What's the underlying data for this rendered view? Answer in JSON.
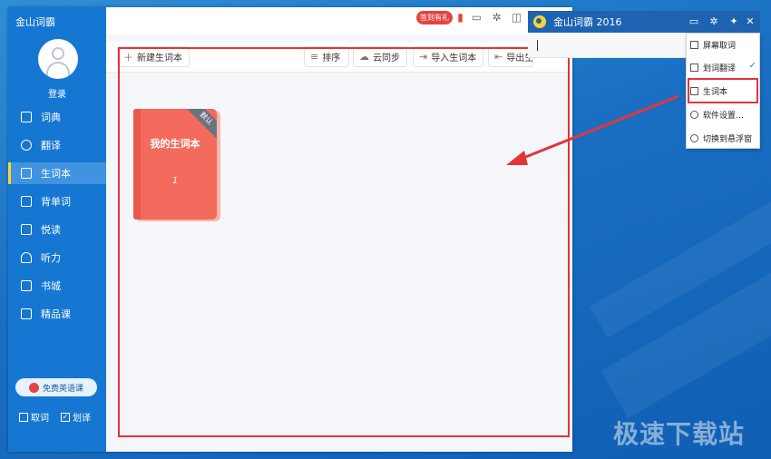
{
  "app": {
    "title": "金山词霸",
    "login": "登录",
    "nav": [
      {
        "label": "词典",
        "icon": "dictionary-icon",
        "glyph": "词"
      },
      {
        "label": "翻译",
        "icon": "translate-icon",
        "glyph": "译"
      },
      {
        "label": "生词本",
        "icon": "wordbook-icon",
        "glyph": "本"
      },
      {
        "label": "背单词",
        "icon": "memorize-icon",
        "glyph": "A"
      },
      {
        "label": "悦读",
        "icon": "reading-icon",
        "glyph": "书"
      },
      {
        "label": "听力",
        "icon": "headphones-icon",
        "glyph": "♪"
      },
      {
        "label": "书城",
        "icon": "bookstore-icon",
        "glyph": "册"
      },
      {
        "label": "精品课",
        "icon": "course-icon",
        "glyph": "▶"
      }
    ],
    "active_nav": "生词本",
    "promo": "免费英语课",
    "checkboxes": {
      "quci": "取词",
      "huayi": "划译"
    }
  },
  "topbar": {
    "checkin": "签到有礼"
  },
  "toolbar": {
    "new_wordbook": "新建生词本",
    "sort": "排序",
    "cloud_sync": "云同步",
    "import": "导入生词本",
    "export": "导出生"
  },
  "wordbook": {
    "title": "我的生词本",
    "count": "1",
    "badge": "默认"
  },
  "mini_window": {
    "title": "金山词霸 2016"
  },
  "menu": {
    "items": [
      {
        "label": "屏幕取词"
      },
      {
        "label": "划词翻译",
        "checked": true
      },
      {
        "label": "生词本"
      },
      {
        "label": "软件设置…"
      },
      {
        "label": "切换到悬浮窗"
      }
    ]
  },
  "watermark": "极速下载站",
  "colors": {
    "sidebar": "#1677d2",
    "accent_red": "#e2353a",
    "book_cover": "#f26b5c"
  }
}
